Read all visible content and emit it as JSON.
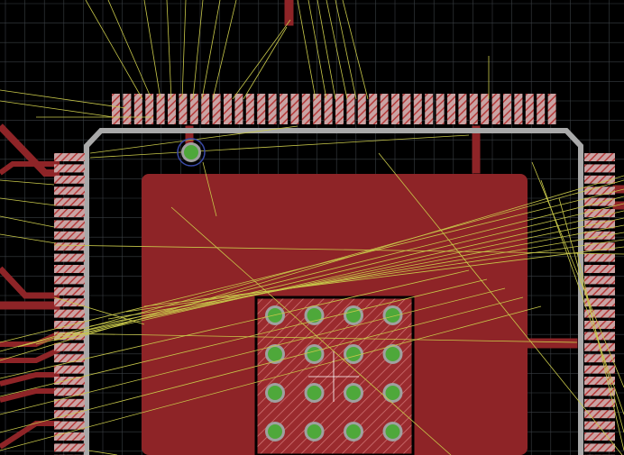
{
  "canvas": {
    "background_color": "#000000",
    "grid_color": "#3a3f44",
    "copper_color": "#8e2427",
    "pad_fill_color": "#c9a3a3",
    "pad_hatch_color": "#b63a3a",
    "silkscreen_color": "#a9a9a9",
    "airwire_color": "#c8c84a",
    "via_fill_color": "#4ea83a",
    "via_ring_color": "#a0a0a0",
    "cursor_color": "#ffffff"
  },
  "chip": {
    "top_pad_count": 40,
    "left_pad_count": 28,
    "right_pad_count": 28
  },
  "thermal_pad": {
    "via_rows": 4,
    "via_cols": 4
  }
}
